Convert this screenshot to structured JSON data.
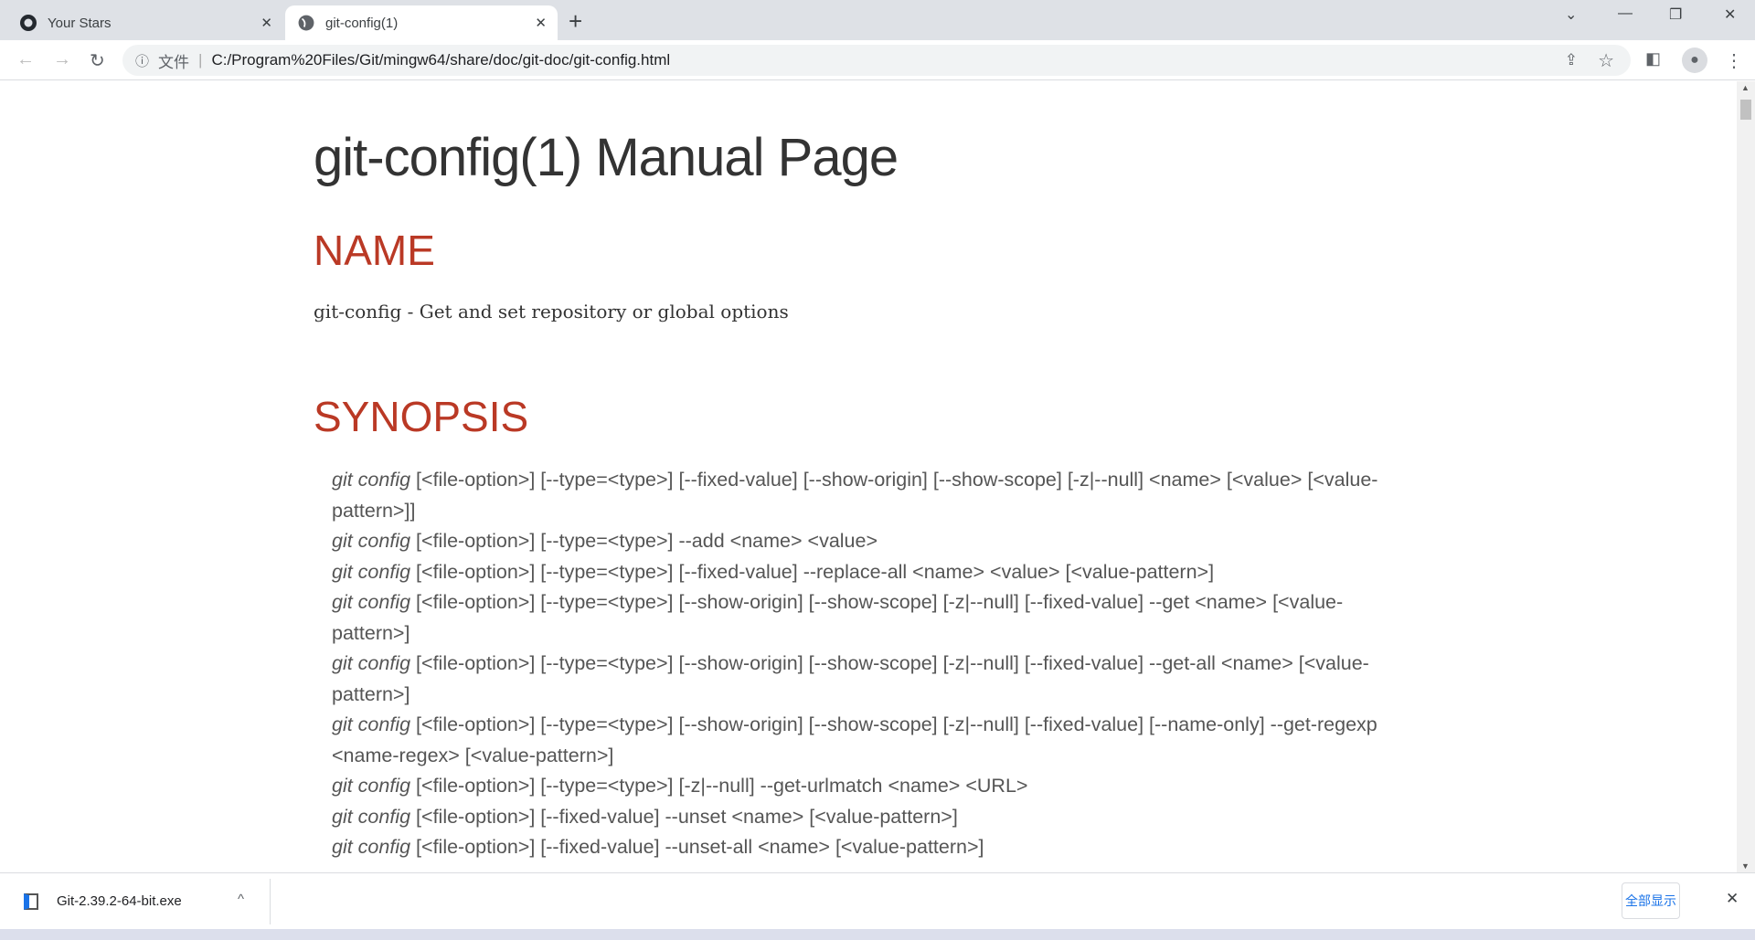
{
  "tabs": [
    {
      "title": "Your Stars",
      "icon": "github-icon"
    },
    {
      "title": "git-config(1)",
      "icon": "globe-icon",
      "active": true
    }
  ],
  "address": {
    "scheme_label": "文件",
    "url": "C:/Program%20Files/Git/mingw64/share/doc/git-doc/git-config.html"
  },
  "page": {
    "title": "git-config(1) Manual Page",
    "name_heading": "NAME",
    "name_text": "git-config - Get and set repository or global options",
    "synopsis_heading": "SYNOPSIS",
    "cmd": "git config",
    "synopsis": [
      "[<file-option>] [--type=<type>] [--fixed-value] [--show-origin] [--show-scope] [-z|--null] <name> [<value> [<value-pattern>]]",
      "[<file-option>] [--type=<type>] --add <name> <value>",
      "[<file-option>] [--type=<type>] [--fixed-value] --replace-all <name> <value> [<value-pattern>]",
      "[<file-option>] [--type=<type>] [--show-origin] [--show-scope] [-z|--null] [--fixed-value] --get <name> [<value-pattern>]",
      "[<file-option>] [--type=<type>] [--show-origin] [--show-scope] [-z|--null] [--fixed-value] --get-all <name> [<value-pattern>]",
      "[<file-option>] [--type=<type>] [--show-origin] [--show-scope] [-z|--null] [--fixed-value] [--name-only] --get-regexp <name-regex> [<value-pattern>]",
      "[<file-option>] [--type=<type>] [-z|--null] --get-urlmatch <name> <URL>",
      "[<file-option>] [--fixed-value] --unset <name> [<value-pattern>]",
      "[<file-option>] [--fixed-value] --unset-all <name> [<value-pattern>]"
    ]
  },
  "downloads": {
    "file": "Git-2.39.2-64-bit.exe",
    "show_all": "全部显示"
  },
  "colors": {
    "heading": "#ba3925",
    "link_blue": "#1a73e8"
  }
}
